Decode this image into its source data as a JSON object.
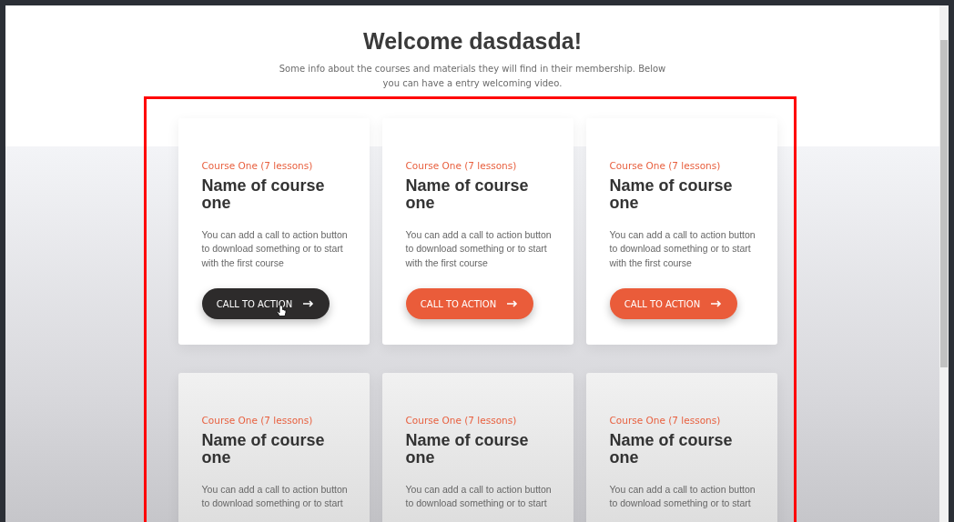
{
  "header": {
    "title": "Welcome dasdasda!",
    "subtitle": "Some info about the courses and materials they will find in their membership. Below you can have a entry welcoming video."
  },
  "highlight": {
    "color": "#ff0000"
  },
  "cards": [
    {
      "label": "Course One (7 lessons)",
      "title": "Name of course one",
      "description": "You can add a call to action button to download something or to start with the first course",
      "button": {
        "label": "CALL TO ACTION",
        "hovered": true
      }
    },
    {
      "label": "Course One (7 lessons)",
      "title": "Name of course one",
      "description": "You can add a call to action button to download something or to start with the first course",
      "button": {
        "label": "CALL TO ACTION",
        "hovered": false
      }
    },
    {
      "label": "Course One (7 lessons)",
      "title": "Name of course one",
      "description": "You can add a call to action button to download something or to start with the first course",
      "button": {
        "label": "CALL TO ACTION",
        "hovered": false
      }
    },
    {
      "label": "Course One (7 lessons)",
      "title": "Name of course one",
      "description": "You can add a call to action button to download something or to start"
    },
    {
      "label": "Course One (7 lessons)",
      "title": "Name of course one",
      "description": "You can add a call to action button to download something or to start"
    },
    {
      "label": "Course One (7 lessons)",
      "title": "Name of course one",
      "description": "You can add a call to action button to download something or to start"
    }
  ]
}
